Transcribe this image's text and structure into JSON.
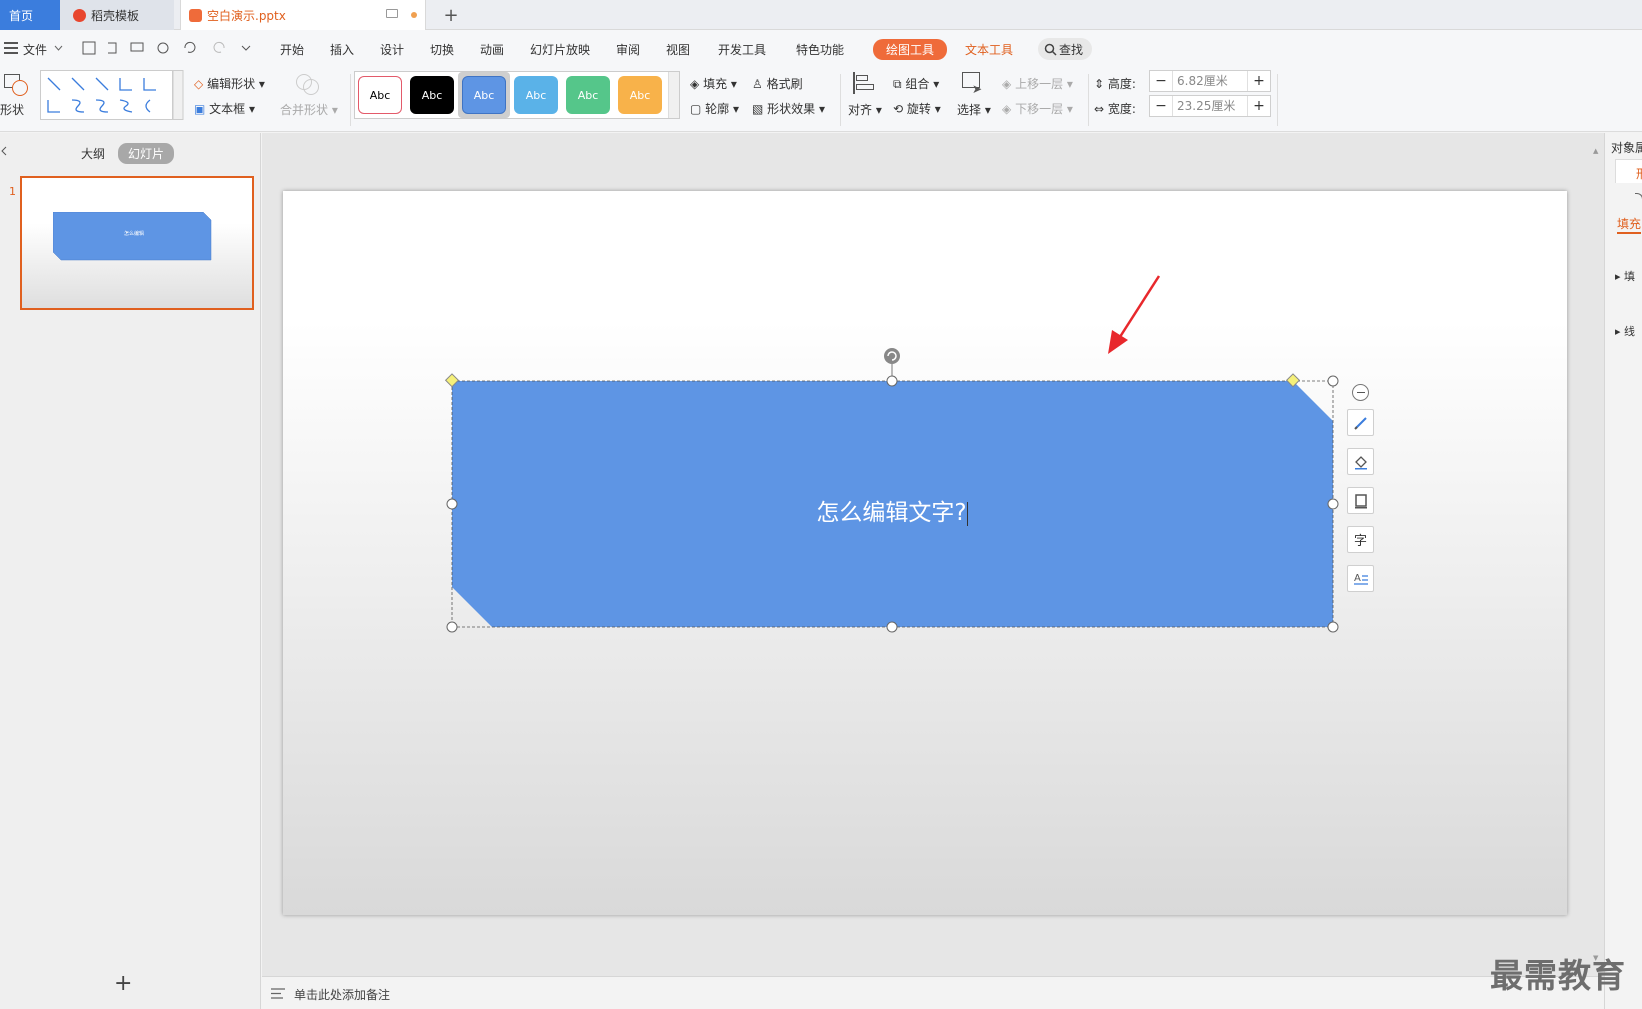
{
  "tabs": [
    {
      "label": "首页"
    },
    {
      "label": "稻壳模板"
    },
    {
      "label": "空白演示.pptx"
    }
  ],
  "menu": {
    "file": "文件",
    "items": [
      "开始",
      "插入",
      "设计",
      "切换",
      "动画",
      "幻灯片放映",
      "审阅",
      "视图",
      "开发工具",
      "特色功能"
    ],
    "drawing_tools": "绘图工具",
    "text_tools": "文本工具",
    "search": "查找"
  },
  "ribbon": {
    "shape": "形状",
    "edit_shape": "编辑形状",
    "text_box": "文本框",
    "merge_shape": "合并形状",
    "style_label": "Abc",
    "fill": "填充",
    "format_painter": "格式刷",
    "outline": "轮廓",
    "shape_effect": "形状效果",
    "align": "对齐",
    "group": "组合",
    "rotate": "旋转",
    "select": "选择",
    "bring_forward": "上移一层",
    "send_backward": "下移一层",
    "height_label": "高度:",
    "height_value": "6.82厘米",
    "width_label": "宽度:",
    "width_value": "23.25厘米",
    "minus": "−",
    "plus": "+"
  },
  "left_panel": {
    "outline_tab": "大纲",
    "slides_tab": "幻灯片",
    "slide_number": "1",
    "thumb_text": "怎么编辑",
    "add": "+"
  },
  "slide": {
    "shape_text": "怎么编辑文字?",
    "shape_color": "#5e95e4"
  },
  "notes": {
    "placeholder": "单击此处添加备注"
  },
  "right_panel": {
    "title": "对象属",
    "tab1": "形",
    "tab2": "填充",
    "item1": "填",
    "item2": "线"
  },
  "watermark": "最需教育",
  "colors": {
    "accent": "#ef6b3a",
    "home_tab": "#3b7ddd",
    "selection_border": "#e0601f",
    "arrow": "#e8282c"
  }
}
